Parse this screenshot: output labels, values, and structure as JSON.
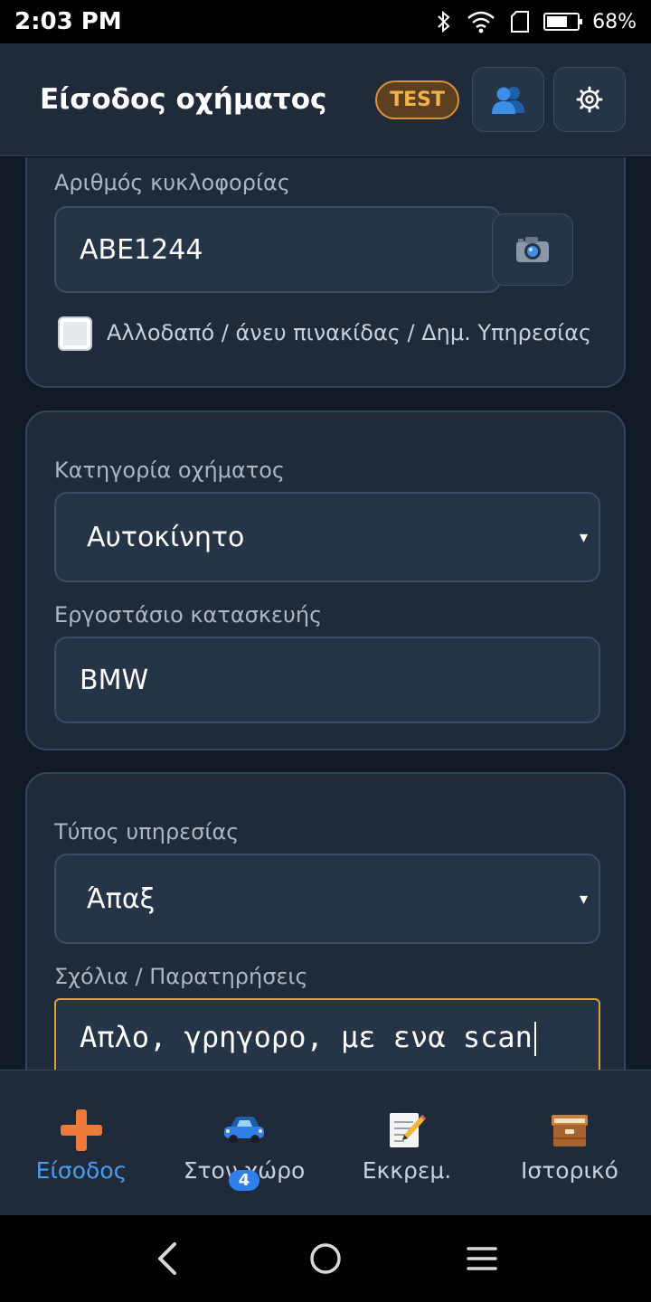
{
  "status_bar": {
    "time": "2:03 PM",
    "battery": "68%",
    "battery_level": 0.68
  },
  "header": {
    "title": "Είσοδος οχήματος",
    "badge": "TEST"
  },
  "plate_card": {
    "label": "Αριθμός κυκλοφορίας",
    "value": "ABE1244",
    "checkbox_label": "Αλλοδαπό / άνευ πινακίδας / Δημ. Υπηρεσίας"
  },
  "vehicle_card": {
    "category_label": "Κατηγορία οχήματος",
    "category_value": "Αυτοκίνητο",
    "make_label": "Εργοστάσιο κατασκευής",
    "make_value": "BMW"
  },
  "service_card": {
    "type_label": "Τύπος υπηρεσίας",
    "type_value": "Άπαξ",
    "comments_label": "Σχόλια / Παρατηρήσεις",
    "comments_value": "Απλο, γρηγορο, με ενα scan"
  },
  "select_arrow": "▾",
  "bottom_nav": {
    "items": [
      {
        "label": "Είσοδος",
        "icon": "plus-icon"
      },
      {
        "label": "Στον χώρο",
        "icon": "car-icon",
        "badge": "4"
      },
      {
        "label": "Εκκρεμ.",
        "icon": "memo-icon"
      },
      {
        "label": "Ιστορικό",
        "icon": "archive-box-icon"
      }
    ]
  },
  "colors": {
    "accent": "#4a9cf0",
    "plus": "#f07a3a",
    "test_badge": "#f3b24e",
    "focus_border": "#d9a236",
    "card": "#1f2a3a",
    "background": "#121a26"
  }
}
